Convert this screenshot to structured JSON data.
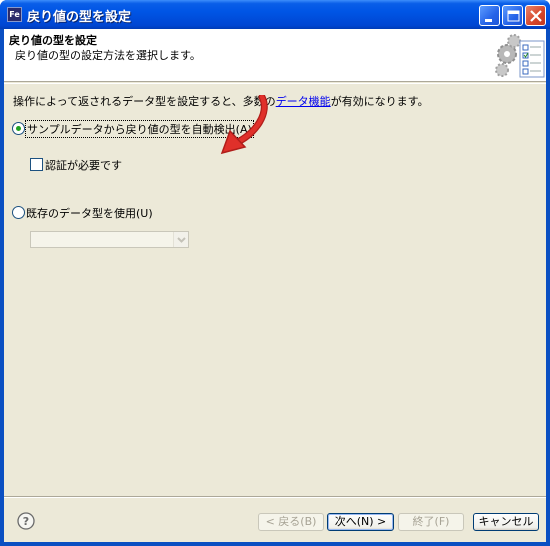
{
  "window": {
    "title": "戻り値の型を設定",
    "app_icon_text": "Fe"
  },
  "header": {
    "title": "戻り値の型を設定",
    "description": "戻り値の型の設定方法を選択します。"
  },
  "content": {
    "info_prefix": "操作によって返されるデータ型を設定すると、多数の",
    "info_link": "データ機能",
    "info_suffix": "が有効になります。",
    "option_auto": "サンプルデータから戻り値の型を自動検出(A)",
    "auth_required": "認証が必要です",
    "option_existing": "既存のデータ型を使用(U)",
    "existing_type_value": ""
  },
  "buttons": {
    "back": "< 戻る(B)",
    "next": "次へ(N) >",
    "finish": "終了(F)",
    "cancel": "キャンセル"
  },
  "state": {
    "auto_selected": true,
    "auth_checked": false,
    "existing_selected": false
  },
  "colors": {
    "titlebar": "#0055e5",
    "dialog_bg": "#ece9d8",
    "radio_dot": "#21a121",
    "annotation_arrow": "#e0302a"
  }
}
